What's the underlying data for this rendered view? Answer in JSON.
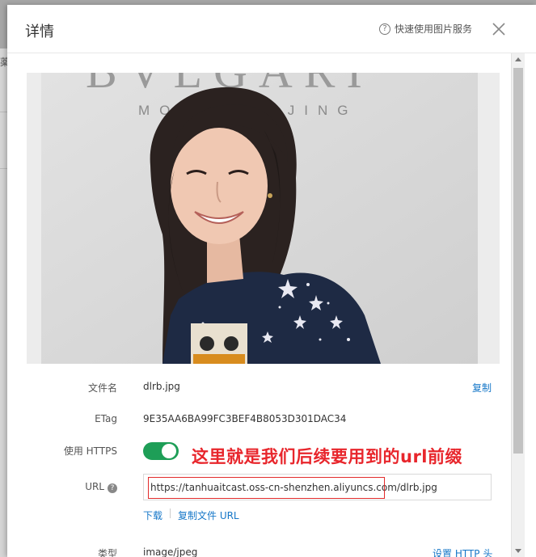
{
  "background": {
    "partial_char": "薬"
  },
  "dialog": {
    "title": "详情",
    "help_link": "快速使用图片服务",
    "close_label": "✕"
  },
  "photo": {
    "sign_text": "BVLGARI",
    "sign_subtext": "MONTEBEIJING"
  },
  "fields": {
    "filename_label": "文件名",
    "filename_value": "dlrb.jpg",
    "copy_label": "复制",
    "etag_label": "ETag",
    "etag_value": "9E35AA6BA99FC3BEF4B8053D301DAC34",
    "https_label": "使用 HTTPS",
    "https_enabled": true,
    "url_label": "URL",
    "url_value": "https://tanhuaitcast.oss-cn-shenzhen.aliyuncs.com/dlrb.jpg",
    "download_label": "下载",
    "copy_url_label": "复制文件 URL",
    "type_label": "类型",
    "type_value": "image/jpeg",
    "http_header_label": "设置 HTTP 头"
  },
  "annotation": "这里就是我们后续要用到的url前缀",
  "colors": {
    "accent": "#1677c8",
    "toggle_on": "#1e9e57",
    "annotation": "#e8262c"
  }
}
